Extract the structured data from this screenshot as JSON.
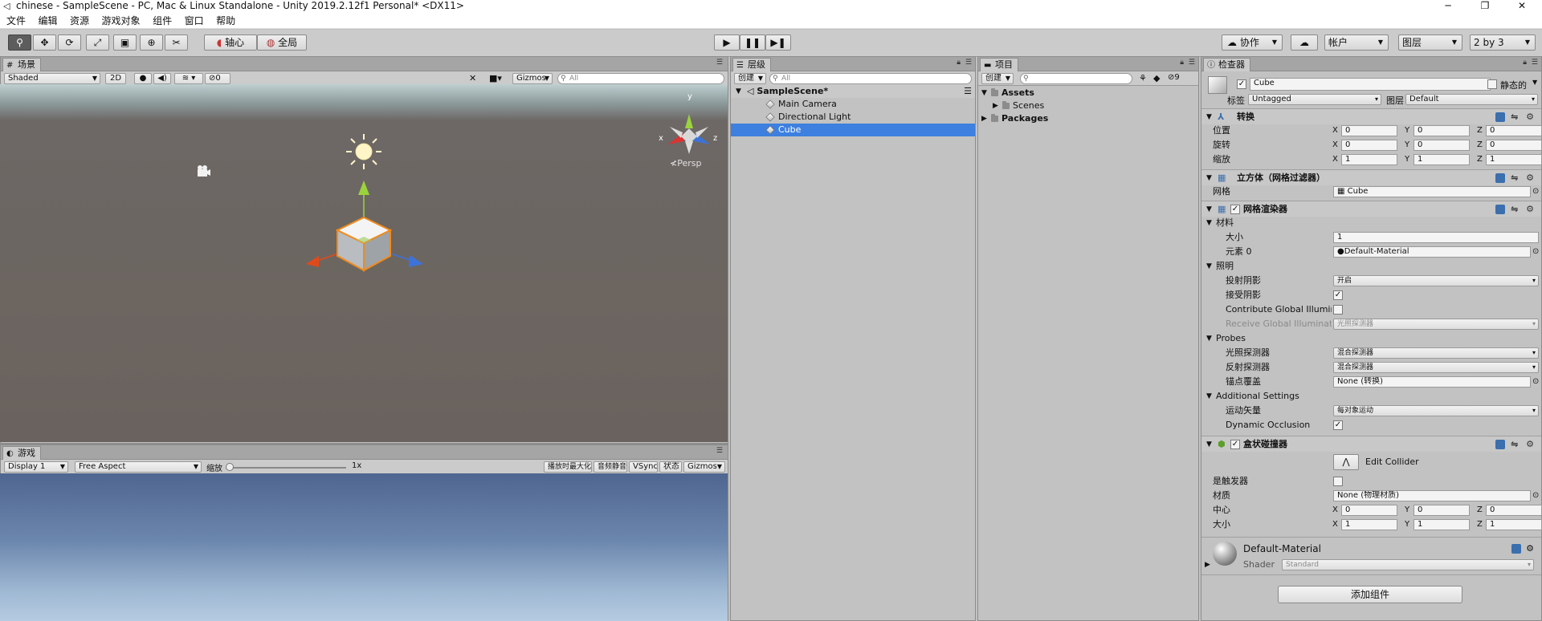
{
  "window": {
    "title": "chinese - SampleScene - PC, Mac & Linux Standalone - Unity 2019.2.12f1 Personal* <DX11>",
    "min_glyph": "─",
    "max_glyph": "❐",
    "close_glyph": "✕"
  },
  "menu": [
    "文件",
    "编辑",
    "资源",
    "游戏对象",
    "组件",
    "窗口",
    "帮助"
  ],
  "toolbar": {
    "pivot": "轴心",
    "global": "全局",
    "collab": "协作",
    "account": "帐户",
    "layers": "图层",
    "layout": "2 by 3"
  },
  "scene": {
    "tab": "场景",
    "shading": "Shaded",
    "mode_2d": "2D",
    "hidden_count": "0",
    "gizmos": "Gizmos",
    "search_placeholder": "All",
    "persp": "Persp",
    "axis_x": "x",
    "axis_y": "y",
    "axis_z": "z"
  },
  "game": {
    "tab": "游戏",
    "display": "Display 1",
    "aspect": "Free Aspect",
    "scale_label": "缩放",
    "scale_value": "1x",
    "maximize": "播放时最大化",
    "mute": "音频静音",
    "vsync": "VSync",
    "stats": "状态",
    "gizmos": "Gizmos"
  },
  "hierarchy": {
    "tab": "层级",
    "create": "创建",
    "search_placeholder": "All",
    "scene": "SampleScene*",
    "items": [
      "Main Camera",
      "Directional Light",
      "Cube"
    ],
    "selected": "Cube"
  },
  "project": {
    "tab": "项目",
    "create": "创建",
    "hidden_count": "9",
    "assets": "Assets",
    "scenes": "Scenes",
    "packages": "Packages"
  },
  "inspector": {
    "tab": "检查器",
    "object_name": "Cube",
    "static_label": "静态的",
    "tag_label": "标签",
    "tag_value": "Untagged",
    "layer_label": "图层",
    "layer_value": "Default",
    "transform": {
      "title": "转换",
      "position_label": "位置",
      "rotation_label": "旋转",
      "scale_label": "缩放",
      "position": [
        "0",
        "0",
        "0"
      ],
      "rotation": [
        "0",
        "0",
        "0"
      ],
      "scale": [
        "1",
        "1",
        "1"
      ]
    },
    "axis_labels": [
      "X",
      "Y",
      "Z"
    ],
    "mesh_filter": {
      "title": "立方体（网格过滤器）",
      "mesh_label": "网格",
      "mesh_value": "Cube"
    },
    "mesh_renderer": {
      "title": "网格渲染器",
      "materials_label": "材料",
      "size_label": "大小",
      "size_value": "1",
      "element0_label": "元素 0",
      "element0_value": "Default-Material",
      "lighting_label": "照明",
      "cast_shadows_label": "投射阴影",
      "cast_shadows_value": "开启",
      "receive_shadows_label": "接受阴影",
      "contribute_gi_label": "Contribute Global Illumina",
      "receive_gi_label": "Receive Global Illuminatio",
      "receive_gi_value": "光照探测器",
      "probes_label": "Probes",
      "light_probes_label": "光照探测器",
      "light_probes_value": "混合探测器",
      "reflection_probes_label": "反射探测器",
      "reflection_probes_value": "混合探测器",
      "anchor_override_label": "锚点覆盖",
      "anchor_override_value": "None (转换)",
      "additional_label": "Additional Settings",
      "motion_vectors_label": "运动矢量",
      "motion_vectors_value": "每对象运动",
      "dynamic_occlusion_label": "Dynamic Occlusion"
    },
    "box_collider": {
      "title": "盒状碰撞器",
      "edit_collider": "Edit Collider",
      "is_trigger_label": "是触发器",
      "material_label": "材质",
      "material_value": "None (物理材质)",
      "center_label": "中心",
      "size_label": "大小",
      "center": [
        "0",
        "0",
        "0"
      ],
      "size": [
        "1",
        "1",
        "1"
      ]
    },
    "material": {
      "name": "Default-Material",
      "shader_label": "Shader",
      "shader_value": "Standard"
    },
    "add_component": "添加组件"
  }
}
